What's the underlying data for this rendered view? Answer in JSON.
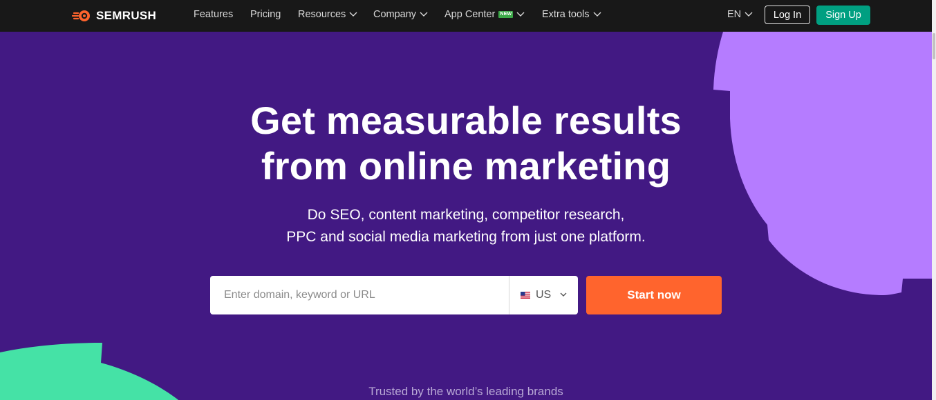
{
  "brand": {
    "name": "SEMRUSH",
    "logo_icon": "semrush-fire-icon"
  },
  "nav": {
    "items": [
      {
        "label": "Features",
        "has_dropdown": false
      },
      {
        "label": "Pricing",
        "has_dropdown": false
      },
      {
        "label": "Resources",
        "has_dropdown": true
      },
      {
        "label": "Company",
        "has_dropdown": true
      },
      {
        "label": "App Center",
        "has_dropdown": true,
        "badge": "NEW"
      },
      {
        "label": "Extra tools",
        "has_dropdown": true
      }
    ],
    "language": "EN",
    "login_label": "Log In",
    "signup_label": "Sign Up"
  },
  "hero": {
    "title_line1": "Get measurable results",
    "title_line2": "from online marketing",
    "subtitle_line1": "Do SEO, content marketing, competitor research,",
    "subtitle_line2": "PPC and social media marketing from just one platform.",
    "search_placeholder": "Enter domain, keyword or URL",
    "search_value": "",
    "country_code": "US",
    "country_flag_icon": "us-flag-icon",
    "cta_label": "Start now"
  },
  "trusted_text": "Trusted by the world’s leading brands",
  "colors": {
    "background": "#421983",
    "nav_background": "#181818",
    "accent_orange": "#ff642d",
    "accent_green": "#009f81",
    "deco_purple": "#b57cff",
    "deco_green": "#45e2a6"
  }
}
